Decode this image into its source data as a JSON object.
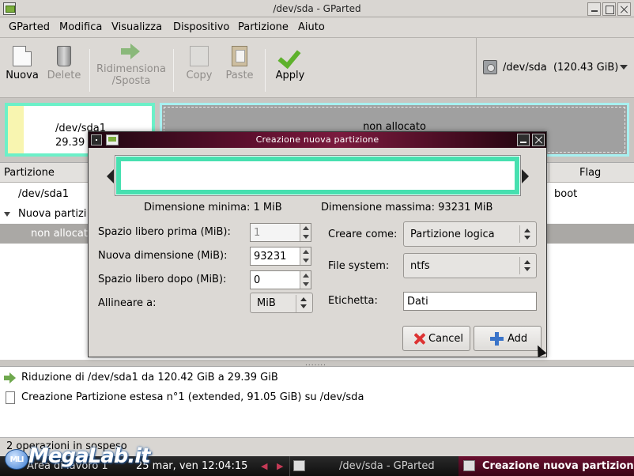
{
  "window": {
    "title": "/dev/sda - GParted"
  },
  "menubar": [
    "GParted",
    "Modifica",
    "Visualizza",
    "Dispositivo",
    "Partizione",
    "Aiuto"
  ],
  "toolbar": {
    "new": "Nuova",
    "delete": "Delete",
    "resize_line1": "Ridimensiona",
    "resize_line2": "/Sposta",
    "copy": "Copy",
    "paste": "Paste",
    "apply": "Apply"
  },
  "device": {
    "label": "/dev/sda  (120.43 GiB)"
  },
  "graph": {
    "sda1_name": "/dev/sda1",
    "sda1_size": "29.39",
    "unallocated": "non allocato"
  },
  "list": {
    "headers": {
      "partition": "Partizione",
      "flag": "Flag"
    },
    "rows": [
      {
        "name": "/dev/sda1",
        "flag": "boot"
      },
      {
        "name": "Nuova partizi"
      },
      {
        "name": "non allocato"
      }
    ]
  },
  "operations": [
    {
      "icon": "resize-icon",
      "text": "Riduzione di /dev/sda1 da 120.42 GiB a 29.39 GiB"
    },
    {
      "icon": "document-icon",
      "text": "Creazione Partizione estesa n°1 (extended, 91.05 GiB) su /dev/sda"
    }
  ],
  "status": {
    "text": "2 operazioni in sospeso"
  },
  "taskbar": {
    "workspace": "Area di lavoro 1",
    "clock": "25 mar, ven 12:04:15",
    "task1": "/dev/sda - GParted",
    "task2": "Creazione nuova partizione"
  },
  "watermark": {
    "text": "MegaLab.it",
    "badge": "MLI"
  },
  "dialog": {
    "title": "Creazione nuova partizione",
    "min_size": "Dimensione minima: 1 MiB",
    "max_size": "Dimensione massima: 93231 MiB",
    "free_before_label": "Spazio libero prima (MiB):",
    "free_before_value": "1",
    "new_size_label": "Nuova dimensione (MiB):",
    "new_size_value": "93231",
    "free_after_label": "Spazio libero dopo (MiB):",
    "free_after_value": "0",
    "align_label": "Allineare a:",
    "align_value": "MiB",
    "create_as_label": "Creare come:",
    "create_as_value": "Partizione logica",
    "filesystem_label": "File system:",
    "filesystem_value": "ntfs",
    "label_label": "Etichetta:",
    "label_value": "Dati",
    "cancel": "Cancel",
    "add": "Add"
  },
  "colors": {
    "partition_border": "#6cf0c8",
    "unallocated_fill": "#a0a0a0",
    "slider_fill": "#47e0b0",
    "dialog_title": "#5e0f2e"
  }
}
